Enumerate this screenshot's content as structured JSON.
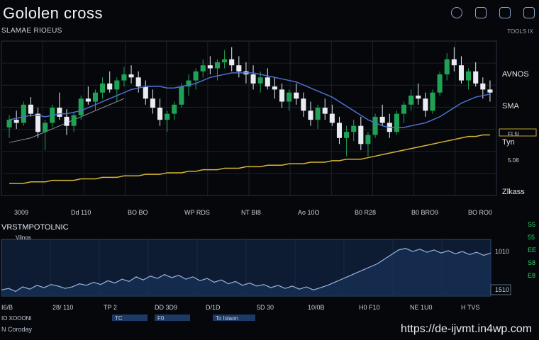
{
  "header": {
    "title": "Gololen cross",
    "subtitle": "SLAMAE RIOEUS",
    "toolbar_icons": [
      "settings-icon",
      "window-icon",
      "link-icon",
      "camera-icon"
    ],
    "top_right_label": "TOOLS IX"
  },
  "price_panel": {
    "right_labels": [
      "AVNOS",
      "SMA",
      "Tyn",
      "Zlkass"
    ],
    "right_values": [
      "5.08",
      "FL5I"
    ],
    "x_tick_labels": [
      "3009",
      "Dd 110",
      "BO BO",
      "WP RDS",
      "NT BI8",
      "Ao 10O",
      "B0 R28",
      "B0 BRO9",
      "BO RO0"
    ],
    "colors": {
      "up": "#1fa255",
      "down": "#e9edf2",
      "fast_ma": "#4f6fd0",
      "slow_ma": "#d8b536",
      "ref_ma": "#8a8f99"
    }
  },
  "indicator_panel": {
    "title": "VRSTMPOTOLNIC",
    "legend": "Vilnos",
    "right_values": [
      "1010",
      "1510"
    ],
    "right_side_labels": [
      "S5",
      "55",
      "EE",
      "S8",
      "E8"
    ],
    "x_tick_labels": [
      "I6/B",
      "28/ 110",
      "TP 2",
      "DD 3D9",
      "D/1D",
      "5D 30",
      "10/0B",
      "H0 F10",
      "NE 1U0",
      "H TVS"
    ],
    "footer_tabs": [
      "TC",
      "F0",
      "To lolaon"
    ],
    "footer_labels": [
      "IO XOOONI",
      "N Coroday"
    ],
    "line_color": "#9bb3d8"
  },
  "watermark": "https://de-ijvmt.in4wp.com",
  "chart_data": {
    "type": "candlestick",
    "title": "Gololen cross",
    "ohlc": [
      [
        55,
        63,
        48,
        60
      ],
      [
        60,
        66,
        54,
        58
      ],
      [
        58,
        72,
        56,
        70
      ],
      [
        70,
        75,
        62,
        64
      ],
      [
        64,
        68,
        48,
        52
      ],
      [
        52,
        60,
        40,
        58
      ],
      [
        58,
        70,
        55,
        68
      ],
      [
        68,
        78,
        60,
        62
      ],
      [
        62,
        67,
        50,
        56
      ],
      [
        56,
        65,
        52,
        63
      ],
      [
        63,
        76,
        60,
        74
      ],
      [
        74,
        82,
        70,
        72
      ],
      [
        72,
        80,
        66,
        78
      ],
      [
        78,
        88,
        74,
        84
      ],
      [
        84,
        92,
        78,
        80
      ],
      [
        80,
        88,
        72,
        86
      ],
      [
        86,
        95,
        82,
        90
      ],
      [
        90,
        96,
        84,
        88
      ],
      [
        88,
        92,
        78,
        82
      ],
      [
        82,
        86,
        70,
        74
      ],
      [
        74,
        80,
        64,
        68
      ],
      [
        68,
        74,
        56,
        60
      ],
      [
        60,
        66,
        52,
        64
      ],
      [
        64,
        72,
        60,
        70
      ],
      [
        70,
        84,
        68,
        82
      ],
      [
        82,
        90,
        76,
        86
      ],
      [
        86,
        94,
        80,
        92
      ],
      [
        92,
        100,
        88,
        96
      ],
      [
        96,
        102,
        90,
        94
      ],
      [
        94,
        100,
        86,
        98
      ],
      [
        98,
        106,
        94,
        100
      ],
      [
        100,
        108,
        92,
        96
      ],
      [
        96,
        102,
        88,
        92
      ],
      [
        92,
        98,
        84,
        90
      ],
      [
        90,
        96,
        80,
        84
      ],
      [
        84,
        92,
        78,
        88
      ],
      [
        88,
        94,
        80,
        82
      ],
      [
        82,
        88,
        74,
        80
      ],
      [
        80,
        84,
        68,
        72
      ],
      [
        72,
        80,
        66,
        78
      ],
      [
        78,
        84,
        70,
        74
      ],
      [
        74,
        78,
        62,
        66
      ],
      [
        66,
        72,
        56,
        60
      ],
      [
        60,
        70,
        54,
        68
      ],
      [
        68,
        74,
        60,
        64
      ],
      [
        64,
        70,
        56,
        58
      ],
      [
        58,
        62,
        44,
        48
      ],
      [
        48,
        56,
        36,
        52
      ],
      [
        52,
        60,
        46,
        56
      ],
      [
        56,
        62,
        40,
        44
      ],
      [
        44,
        52,
        36,
        50
      ],
      [
        50,
        64,
        48,
        62
      ],
      [
        62,
        70,
        56,
        58
      ],
      [
        58,
        64,
        48,
        52
      ],
      [
        52,
        66,
        50,
        64
      ],
      [
        64,
        72,
        58,
        70
      ],
      [
        70,
        80,
        66,
        76
      ],
      [
        76,
        84,
        70,
        74
      ],
      [
        74,
        78,
        62,
        66
      ],
      [
        66,
        80,
        64,
        78
      ],
      [
        78,
        92,
        76,
        90
      ],
      [
        90,
        104,
        86,
        100
      ],
      [
        100,
        108,
        92,
        96
      ],
      [
        96,
        102,
        84,
        86
      ],
      [
        86,
        94,
        80,
        92
      ],
      [
        92,
        98,
        82,
        84
      ],
      [
        84,
        88,
        74,
        80
      ],
      [
        80,
        86,
        72,
        78
      ]
    ],
    "fast_ma": [
      60,
      61,
      62,
      63,
      63,
      62,
      63,
      64,
      64,
      65,
      66,
      68,
      70,
      72,
      74,
      76,
      78,
      80,
      81,
      82,
      82,
      82,
      81,
      81,
      82,
      83,
      84,
      86,
      88,
      89,
      90,
      91,
      91,
      91,
      91,
      90,
      89,
      88,
      87,
      86,
      85,
      83,
      81,
      79,
      77,
      75,
      72,
      69,
      66,
      63,
      60,
      58,
      56,
      55,
      55,
      55,
      56,
      57,
      58,
      60,
      62,
      65,
      68,
      71,
      73,
      75,
      76,
      77
    ],
    "slow_ma": [
      18,
      18,
      18,
      19,
      19,
      19,
      20,
      20,
      20,
      20,
      21,
      21,
      21,
      22,
      22,
      22,
      23,
      23,
      23,
      24,
      24,
      24,
      25,
      25,
      25,
      26,
      26,
      27,
      27,
      27,
      28,
      28,
      28,
      29,
      29,
      29,
      30,
      30,
      30,
      31,
      31,
      31,
      32,
      32,
      32,
      33,
      33,
      34,
      34,
      34,
      35,
      36,
      37,
      38,
      39,
      40,
      41,
      42,
      43,
      44,
      45,
      46,
      47,
      48,
      49,
      49,
      50,
      50
    ],
    "ref_ma": [
      45,
      46,
      47,
      48,
      50,
      52,
      54,
      56,
      58,
      60,
      62,
      64,
      66,
      68,
      70,
      72,
      74
    ],
    "ylim": [
      10,
      112
    ],
    "indicator_series": [
      38,
      40,
      36,
      42,
      39,
      44,
      41,
      45,
      43,
      40,
      42,
      46,
      44,
      48,
      45,
      50,
      47,
      52,
      49,
      55,
      51,
      56,
      53,
      58,
      54,
      57,
      52,
      55,
      50,
      53,
      48,
      51,
      46,
      49,
      44,
      47,
      43,
      45,
      41,
      44,
      40,
      43,
      39,
      42,
      38,
      41,
      44,
      48,
      52,
      56,
      60,
      64,
      68,
      72,
      78,
      84,
      90,
      92,
      88,
      91,
      87,
      90,
      86,
      89,
      85,
      88,
      84,
      87,
      83,
      86
    ]
  }
}
